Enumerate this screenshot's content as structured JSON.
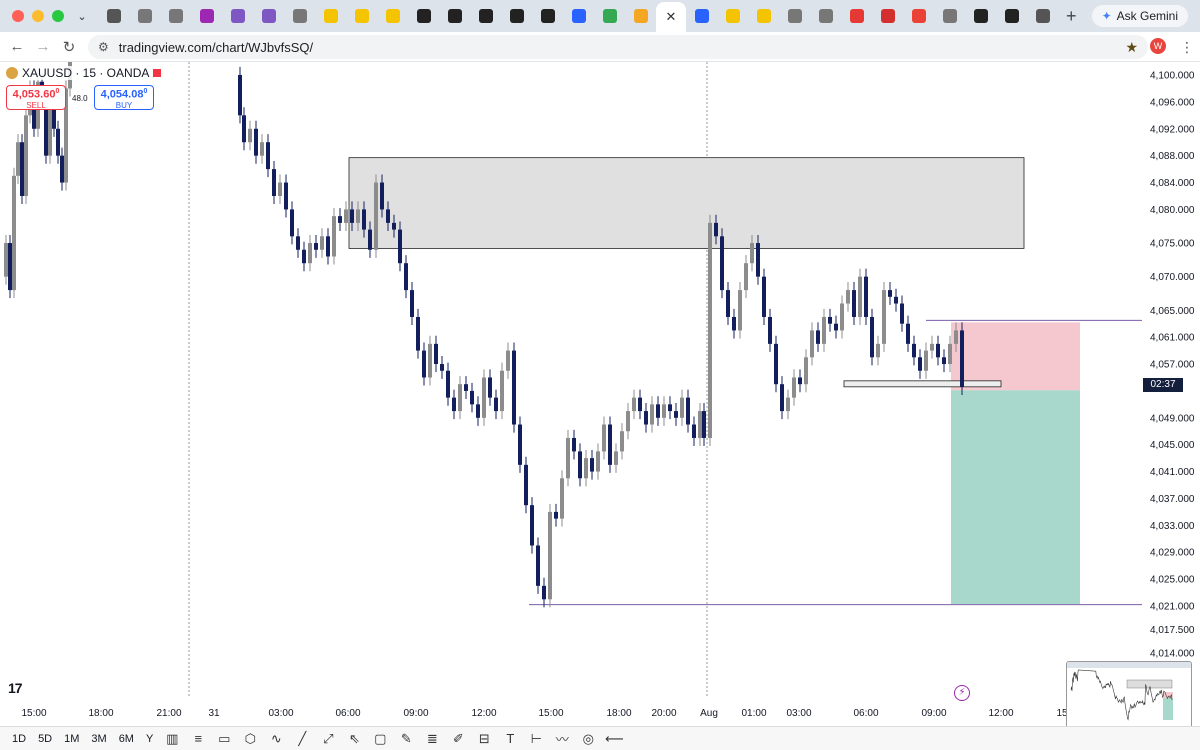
{
  "browser": {
    "url": "tradingview.com/chart/WJbvfsSQ/",
    "ask_gemini": "Ask Gemini",
    "profile_initial": "W",
    "tabs": [
      {
        "icon": "chatgpt-icon",
        "color": "#555"
      },
      {
        "icon": "chrome-icon",
        "color": "#777"
      },
      {
        "icon": "chrome-icon",
        "color": "#777"
      },
      {
        "icon": "app-icon",
        "color": "#9c27b0"
      },
      {
        "icon": "circle-icon",
        "color": "#7e57c2"
      },
      {
        "icon": "circle-icon",
        "color": "#7e57c2"
      },
      {
        "icon": "chrome-icon",
        "color": "#777"
      },
      {
        "icon": "ex-icon",
        "color": "#f5c400"
      },
      {
        "icon": "ex-icon",
        "color": "#f5c400"
      },
      {
        "icon": "ex-icon",
        "color": "#f5c400"
      },
      {
        "icon": "p-icon",
        "color": "#222"
      },
      {
        "icon": "p-icon",
        "color": "#222"
      },
      {
        "icon": "p-icon",
        "color": "#222"
      },
      {
        "icon": "p-icon",
        "color": "#222"
      },
      {
        "icon": "p-icon",
        "color": "#222"
      },
      {
        "icon": "play-icon",
        "color": "#2962ff"
      },
      {
        "icon": "play-store-icon",
        "color": "#34a853"
      },
      {
        "icon": "bell-icon",
        "color": "#f5a623"
      },
      {
        "icon": "close-icon",
        "active": true
      },
      {
        "icon": "chart-icon",
        "color": "#2962ff"
      },
      {
        "icon": "ex-icon",
        "color": "#f5c400"
      },
      {
        "icon": "ex-icon",
        "color": "#f5c400"
      },
      {
        "icon": "chrome-icon",
        "color": "#777"
      },
      {
        "icon": "chrome-icon",
        "color": "#777"
      },
      {
        "icon": "app-icon",
        "color": "#e53935"
      },
      {
        "icon": "app-icon",
        "color": "#d32f2f"
      },
      {
        "icon": "gmail-icon",
        "color": "#ea4335"
      },
      {
        "icon": "chrome-icon",
        "color": "#777"
      },
      {
        "icon": "app-icon",
        "color": "#222"
      },
      {
        "icon": "app-icon",
        "color": "#222"
      },
      {
        "icon": "fn-icon",
        "color": "#555"
      }
    ]
  },
  "symbol": {
    "name": "XAUUSD · 15 · OANDA",
    "sell_price": "4,053.60",
    "sell_sup": "0",
    "sell_label": "SELL",
    "spread": "48.0",
    "buy_price": "4,054.08",
    "buy_sup": "0",
    "buy_label": "BUY",
    "countdown": "02:37"
  },
  "timeframes": [
    "1D",
    "5D",
    "1M",
    "3M",
    "6M",
    "Y"
  ],
  "toolbar_icons": [
    "candles-icon",
    "lines-icon",
    "rect-icon",
    "pattern-icon",
    "path-icon",
    "ray-icon",
    "trend-icon",
    "cursor-icon",
    "note-icon",
    "brush-icon",
    "fib-icon",
    "pen-icon",
    "measure-icon",
    "text-icon",
    "price-range-icon",
    "wave-icon",
    "ellipse-icon",
    "line-icon"
  ],
  "colors": {
    "up": "#8c8c8c",
    "down": "#131f5c",
    "supply_zone": "#e0e0e0",
    "stop_zone": "#f5c8cf",
    "target_zone": "#a8d8cc",
    "level_line": "#7b5ea7",
    "price_tag": "#131f3d"
  },
  "chart_data": {
    "type": "candlestick",
    "symbol": "XAUUSD",
    "interval": "15",
    "y_ticks": [
      "4,100.000",
      "4,096.000",
      "4,092.000",
      "4,088.000",
      "4,084.000",
      "4,080.000",
      "4,075.000",
      "4,070.000",
      "4,065.000",
      "4,061.000",
      "4,057.000",
      "4,049.000",
      "4,045.000",
      "4,041.000",
      "4,037.000",
      "4,033.000",
      "4,029.000",
      "4,025.000",
      "4,021.000",
      "4,017.500",
      "4,014.000"
    ],
    "y_values": [
      4100,
      4096,
      4092,
      4088,
      4084,
      4080,
      4075,
      4070,
      4065,
      4061,
      4057,
      4049,
      4045,
      4041,
      4037,
      4033,
      4029,
      4025,
      4021,
      4017.5,
      4014
    ],
    "x_ticks": [
      "15:00",
      "18:00",
      "21:00",
      "31",
      "03:00",
      "06:00",
      "09:00",
      "12:00",
      "15:00",
      "18:00",
      "20:00",
      "Aug",
      "01:00",
      "03:00",
      "06:00",
      "09:00",
      "12:00",
      "15"
    ],
    "current_price": 4053.6,
    "levels": [
      4063.5,
      4021.2
    ],
    "zones": [
      {
        "kind": "supply",
        "from": 4074.2,
        "to": 4087.7
      },
      {
        "kind": "stop",
        "from": 4053.1,
        "to": 4063.2
      },
      {
        "kind": "target",
        "from": 4021.3,
        "to": 4053.1
      }
    ]
  }
}
